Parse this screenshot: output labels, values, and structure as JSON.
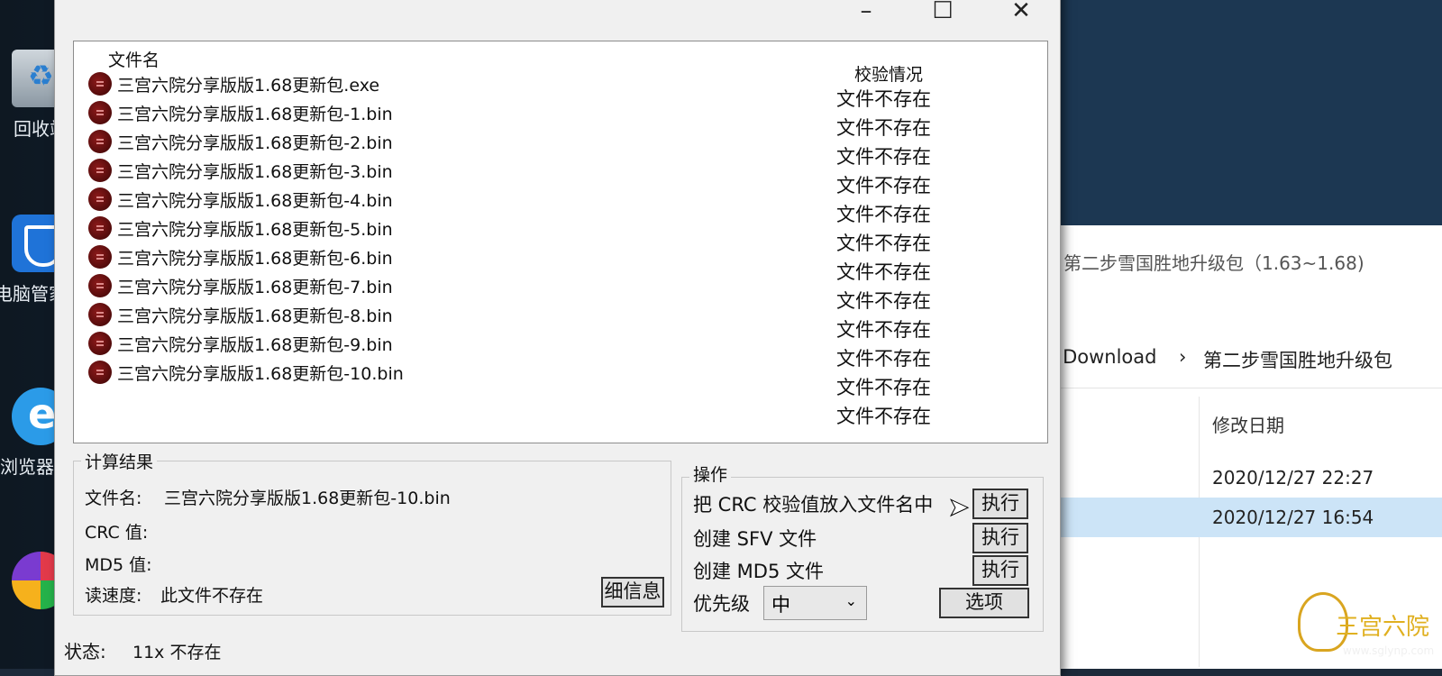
{
  "desktop": {
    "icons": [
      {
        "label": "回收站",
        "icon": "recycle-bin-icon"
      },
      {
        "label": "电脑管家",
        "icon": "pc-manager-shield-icon"
      },
      {
        "label": "浏览器",
        "icon": "browser-e-icon"
      },
      {
        "label": "",
        "icon": "game-clover-icon"
      }
    ]
  },
  "explorer": {
    "title": "第二步雪国胜地升级包（1.63~1.68)",
    "breadcrumb": [
      ":Download",
      "›",
      "第二步雪国胜地升级包"
    ],
    "column_header": "修改日期",
    "rows": [
      {
        "date": "2020/12/27 22:27",
        "selected": false
      },
      {
        "date": "2020/12/27 16:54",
        "selected": true
      }
    ]
  },
  "dialog": {
    "title_buttons": {
      "maximize": "☐",
      "close": "✕"
    },
    "list": {
      "col_filename": "文件名",
      "col_check": "校验情况",
      "rows": [
        {
          "name": "三宫六院分享版版1.68更新包.exe",
          "status": "文件不存在"
        },
        {
          "name": "三宫六院分享版版1.68更新包-1.bin",
          "status": "文件不存在"
        },
        {
          "name": "三宫六院分享版版1.68更新包-2.bin",
          "status": "文件不存在"
        },
        {
          "name": "三宫六院分享版版1.68更新包-3.bin",
          "status": "文件不存在"
        },
        {
          "name": "三宫六院分享版版1.68更新包-4.bin",
          "status": "文件不存在"
        },
        {
          "name": "三宫六院分享版版1.68更新包-5.bin",
          "status": "文件不存在"
        },
        {
          "name": "三宫六院分享版版1.68更新包-6.bin",
          "status": "文件不存在"
        },
        {
          "name": "三宫六院分享版版1.68更新包-7.bin",
          "status": "文件不存在"
        },
        {
          "name": "三宫六院分享版版1.68更新包-8.bin",
          "status": "文件不存在"
        },
        {
          "name": "三宫六院分享版版1.68更新包-9.bin",
          "status": "文件不存在"
        },
        {
          "name": "三宫六院分享版版1.68更新包-10.bin",
          "status": "文件不存在"
        },
        {
          "name": "",
          "status": "文件不存在"
        }
      ]
    },
    "result": {
      "title": "计算结果",
      "filename_label": "文件名:",
      "filename_value": "三宫六院分享版版1.68更新包-10.bin",
      "crc_label": "CRC 值:",
      "md5_label": "MD5 值:",
      "speed_label": "读速度:",
      "speed_value": "此文件不存在",
      "details_button": "细信息"
    },
    "ops": {
      "title": "操作",
      "crc_to_name_label": "把 CRC 校验值放入文件名中",
      "create_sfv_label": "创建 SFV 文件",
      "create_md5_label": "创建 MD5 文件",
      "priority_label": "优先级",
      "priority_value": "中",
      "execute_label": "执行",
      "options_button": "选项"
    },
    "status": {
      "label": "状态:",
      "value": "11x 不存在"
    }
  },
  "watermark": {
    "text": "三宫六院",
    "url": "www.sglynp.com"
  }
}
